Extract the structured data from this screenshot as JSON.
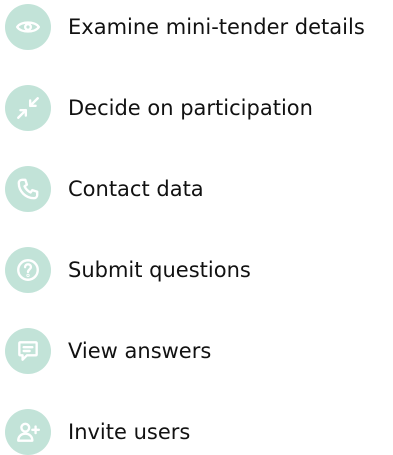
{
  "menu": {
    "items": [
      {
        "label": "Examine mini-tender details",
        "icon": "eye-icon"
      },
      {
        "label": "Decide on participation",
        "icon": "arrows-inward-icon"
      },
      {
        "label": "Contact data",
        "icon": "phone-icon"
      },
      {
        "label": "Submit questions",
        "icon": "question-icon"
      },
      {
        "label": "View answers",
        "icon": "chat-bubble-icon"
      },
      {
        "label": "Invite users",
        "icon": "user-plus-icon"
      }
    ]
  },
  "colors": {
    "icon_background": "#c2e3d8",
    "icon_glyph": "#ffffff",
    "text": "#111111"
  }
}
